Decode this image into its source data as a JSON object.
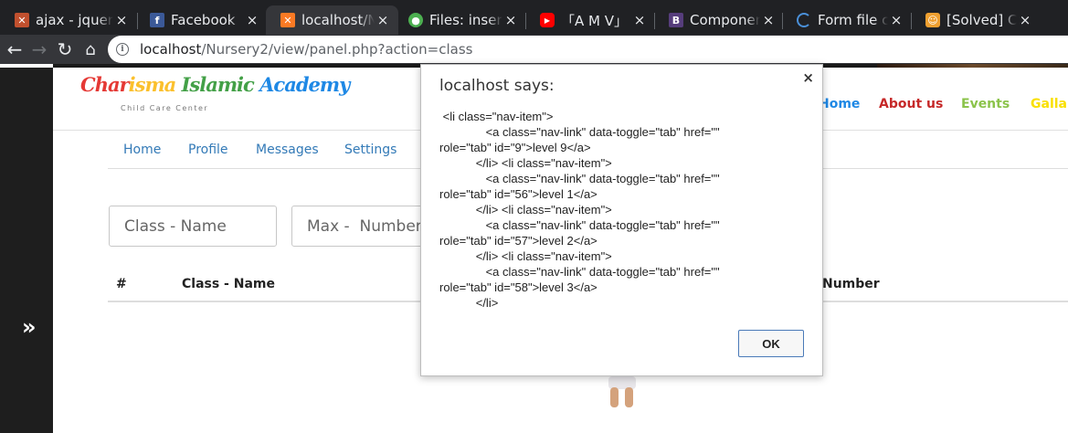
{
  "browser": {
    "tabs": [
      {
        "title": "ajax - jquery",
        "icon": "xampp-icon",
        "icon_color": "#c1502e",
        "active": false
      },
      {
        "title": "Facebook",
        "icon": "facebook-icon",
        "icon_color": "#3b5998",
        "active": false
      },
      {
        "title": "localhost/N",
        "icon": "xampp-icon",
        "icon_color": "#fb7a24",
        "active": true
      },
      {
        "title": "Files: insert",
        "icon": "chrome-icon",
        "icon_color": "#4caf50",
        "active": false
      },
      {
        "title": "「A M V」",
        "icon": "youtube-icon",
        "icon_color": "#ff0000",
        "active": false
      },
      {
        "title": "Component",
        "icon": "bootstrap-icon",
        "icon_color": "#563d7c",
        "active": false
      },
      {
        "title": "Form file co",
        "icon": "loading-icon",
        "icon_color": "#4a90d9",
        "active": false
      },
      {
        "title": "[Solved] Ca",
        "icon": "codeproject-icon",
        "icon_color": "#f0a030",
        "active": false
      }
    ],
    "close_glyph": "×",
    "address": {
      "host": "localhost",
      "path": "/Nursery2/view/panel.php?action=class"
    }
  },
  "site": {
    "logo_text": [
      "Char",
      "isma ",
      "Islamic ",
      "Academy"
    ],
    "logo_subtitle": "Child Care Center",
    "nav": [
      {
        "label": "Home",
        "color": "#1e88e5"
      },
      {
        "label": "About us",
        "color": "#c62828"
      },
      {
        "label": "Events",
        "color": "#8bc34a"
      },
      {
        "label": "Gallar",
        "color": "#f9e000"
      }
    ]
  },
  "panel": {
    "tabs": [
      "Home",
      "Profile",
      "Messages",
      "Settings"
    ],
    "inputs": {
      "class_name_placeholder": "Class - Name",
      "max_number_placeholder": "Max -  Number"
    },
    "table_headers": [
      "#",
      "Class - Name",
      "Number"
    ]
  },
  "dialog": {
    "title": "localhost says:",
    "close": "×",
    "message_lines": [
      " <li class=\"nav-item\">",
      "              <a class=\"nav-link\" data-toggle=\"tab\" href=\"\"",
      "role=\"tab\" id=\"9\">level 9</a>",
      "           </li> <li class=\"nav-item\">",
      "              <a class=\"nav-link\" data-toggle=\"tab\" href=\"\"",
      "role=\"tab\" id=\"56\">level 1</a>",
      "           </li> <li class=\"nav-item\">",
      "              <a class=\"nav-link\" data-toggle=\"tab\" href=\"\"",
      "role=\"tab\" id=\"57\">level 2</a>",
      "           </li> <li class=\"nav-item\">",
      "              <a class=\"nav-link\" data-toggle=\"tab\" href=\"\"",
      "role=\"tab\" id=\"58\">level 3</a>",
      "           </li>"
    ],
    "ok_label": "OK"
  },
  "sidebar": {
    "toggle_glyph": "»"
  }
}
